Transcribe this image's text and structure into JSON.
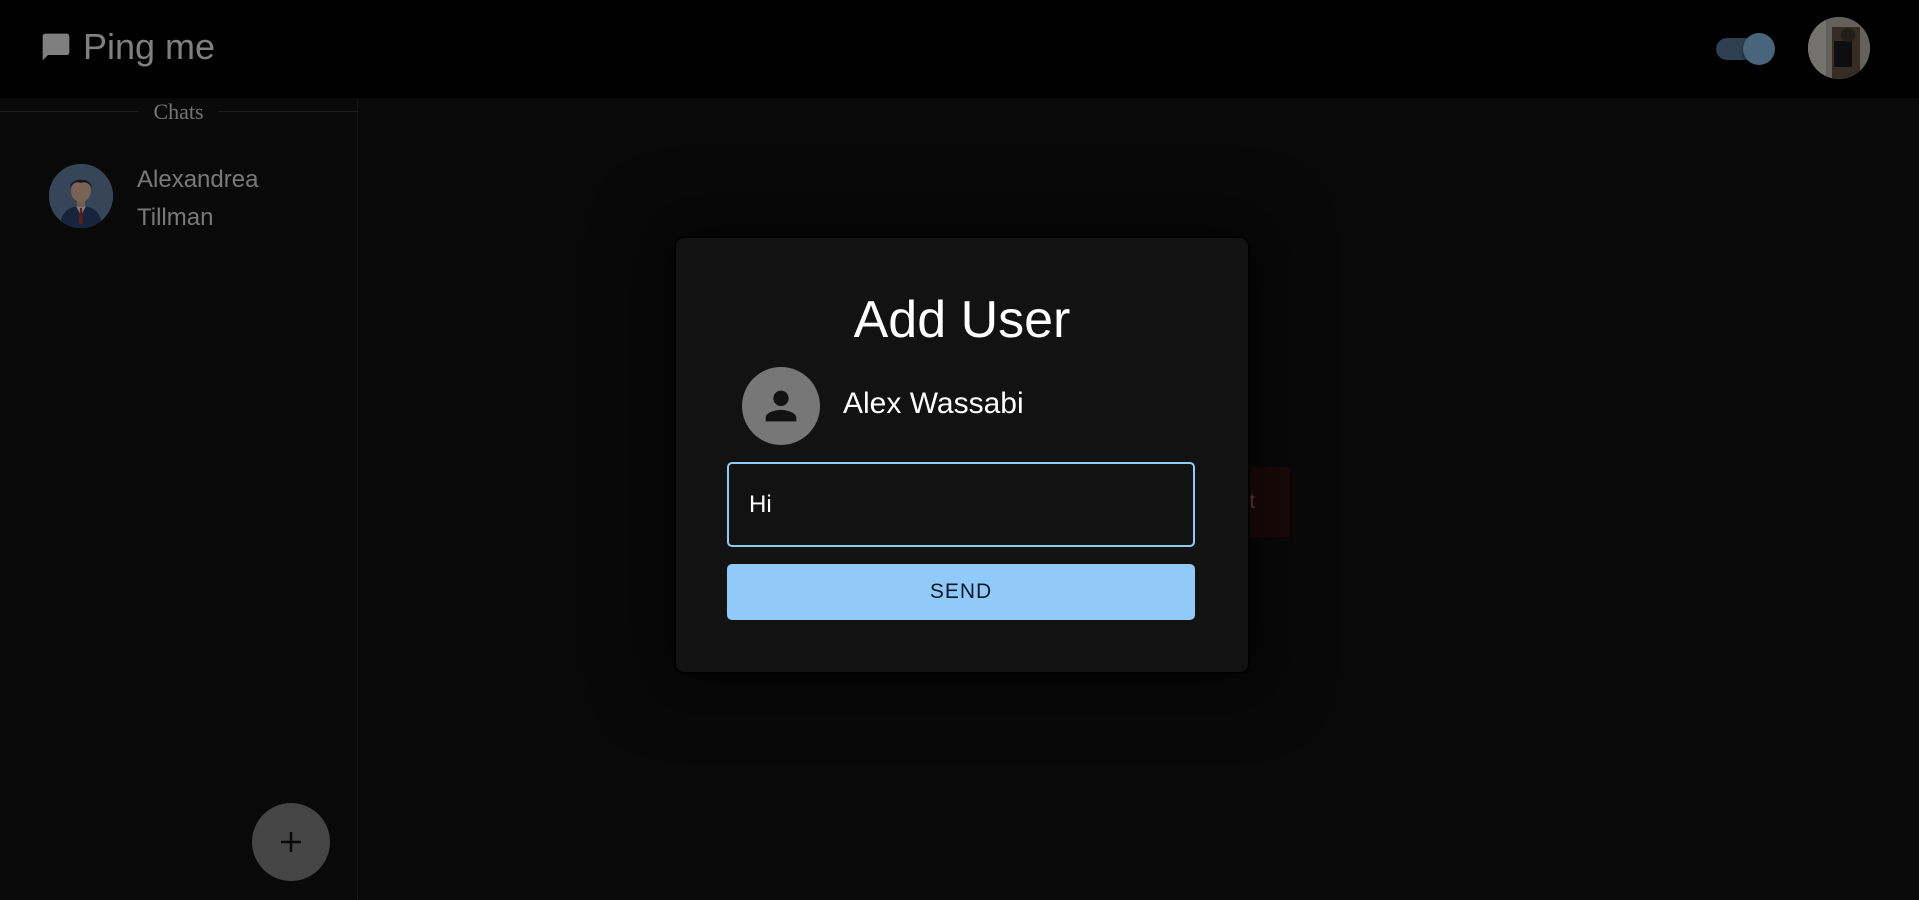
{
  "app": {
    "title": "Ping me",
    "brand_icon": "chat-bubble-icon",
    "theme_toggle": "on",
    "user_avatar": "user-photo"
  },
  "sidebar": {
    "section_label": "Chats",
    "chats": [
      {
        "name_line1": "Alexandrea",
        "name_line2": "Tillman",
        "avatar": "businessman-avatar"
      }
    ],
    "add_button_icon": "plus-icon"
  },
  "main": {
    "start_chat_text": "hat"
  },
  "dialog": {
    "title": "Add User",
    "contact_name": "Alex Wassabi",
    "contact_avatar": "person-icon",
    "message_value": "Hi",
    "send_label": "SEND"
  },
  "colors": {
    "accent": "#90caf9",
    "appbar": "#000000",
    "background": "#121212"
  }
}
